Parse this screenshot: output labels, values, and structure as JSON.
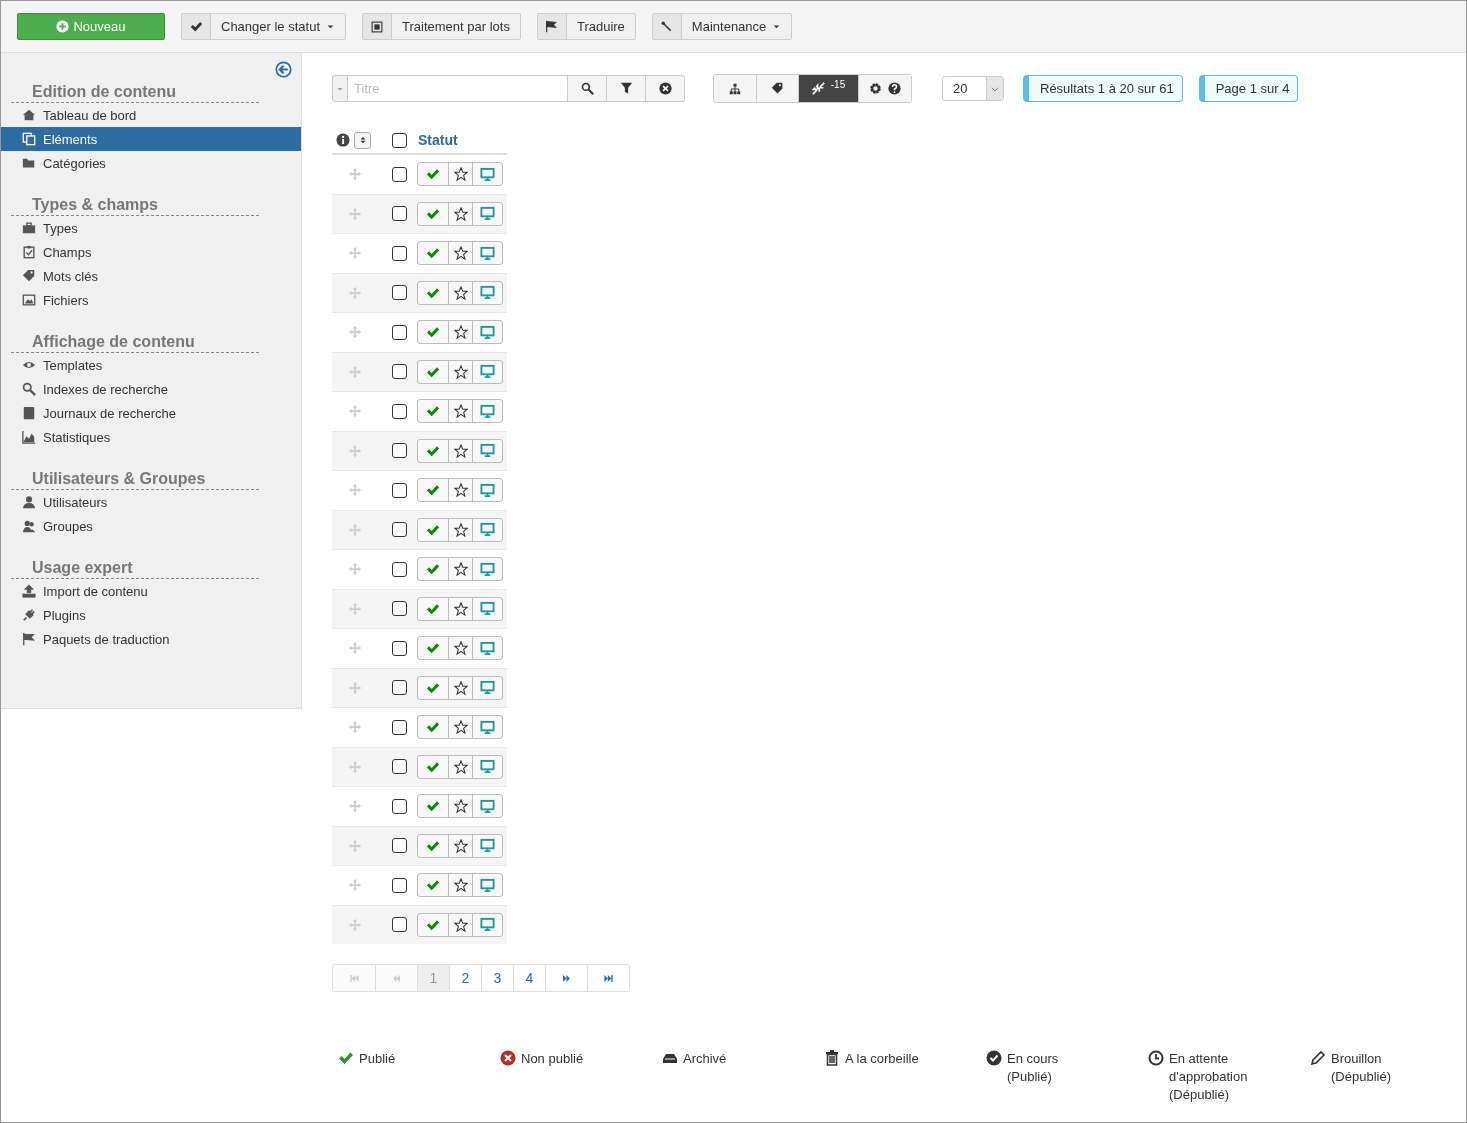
{
  "toolbar": [
    {
      "label": "Nouveau",
      "kind": "primary"
    },
    {
      "label": "Changer le statut",
      "kind": "dropdown"
    },
    {
      "label": "Traitement par lots",
      "kind": "split"
    },
    {
      "label": "Traduire",
      "kind": "split"
    },
    {
      "label": "Maintenance",
      "kind": "dropdown"
    }
  ],
  "sidebar": {
    "sections": [
      {
        "title": "Edition de contenu",
        "items": [
          {
            "label": "Tableau de bord",
            "selected": false
          },
          {
            "label": "Eléments",
            "selected": true
          },
          {
            "label": "Catégories",
            "selected": false
          }
        ]
      },
      {
        "title": "Types & champs",
        "items": [
          {
            "label": "Types",
            "selected": false
          },
          {
            "label": "Champs",
            "selected": false
          },
          {
            "label": "Mots clés",
            "selected": false
          },
          {
            "label": "Fichiers",
            "selected": false
          }
        ]
      },
      {
        "title": "Affichage de contenu",
        "items": [
          {
            "label": "Templates",
            "selected": false
          },
          {
            "label": "Indexes de recherche",
            "selected": false
          },
          {
            "label": "Journaux de recherche",
            "selected": false
          },
          {
            "label": "Statistiques",
            "selected": false
          }
        ]
      },
      {
        "title": "Utilisateurs & Groupes",
        "items": [
          {
            "label": "Utilisateurs",
            "selected": false
          },
          {
            "label": "Groupes",
            "selected": false
          }
        ]
      },
      {
        "title": "Usage expert",
        "items": [
          {
            "label": "Import de contenu",
            "selected": false
          },
          {
            "label": "Plugins",
            "selected": false
          },
          {
            "label": "Paquets de traduction",
            "selected": false
          }
        ]
      }
    ]
  },
  "filters": {
    "search": {
      "placeholder": "Titre"
    },
    "view_buttons": [
      {
        "selected": false
      },
      {
        "selected": false
      },
      {
        "selected": true,
        "badge": "-15"
      },
      {
        "selected": false
      }
    ],
    "page_size": "20",
    "results_label": "Résultats 1 à 20 sur 61",
    "page_label": "Page 1 sur 4"
  },
  "table": {
    "columns": [
      "Statut"
    ],
    "header_checked": false,
    "rows": [
      {
        "checked": false
      },
      {
        "checked": false
      },
      {
        "checked": false
      },
      {
        "checked": false
      },
      {
        "checked": false
      },
      {
        "checked": false
      },
      {
        "checked": false
      },
      {
        "checked": false
      },
      {
        "checked": false
      },
      {
        "checked": false
      },
      {
        "checked": false
      },
      {
        "checked": false
      },
      {
        "checked": false
      },
      {
        "checked": false
      },
      {
        "checked": false
      },
      {
        "checked": false
      },
      {
        "checked": false
      },
      {
        "checked": false
      },
      {
        "checked": false
      },
      {
        "checked": false
      }
    ]
  },
  "pagination": [
    {
      "kind": "first",
      "disabled": true
    },
    {
      "kind": "prev",
      "disabled": true
    },
    {
      "kind": "page",
      "label": "1",
      "selected": true
    },
    {
      "kind": "page",
      "label": "2",
      "selected": false
    },
    {
      "kind": "page",
      "label": "3",
      "selected": false
    },
    {
      "kind": "page",
      "label": "4",
      "selected": false
    },
    {
      "kind": "next",
      "disabled": false
    },
    {
      "kind": "last",
      "disabled": false
    }
  ],
  "legend": [
    {
      "kind": "published",
      "lines": [
        "Publié"
      ]
    },
    {
      "kind": "unpublished",
      "lines": [
        "Non publié"
      ]
    },
    {
      "kind": "archived",
      "lines": [
        "Archivé"
      ]
    },
    {
      "kind": "trashed",
      "lines": [
        "A la corbeille"
      ]
    },
    {
      "kind": "in_progress",
      "lines": [
        "En cours",
        "(Publié)"
      ]
    },
    {
      "kind": "pending",
      "lines": [
        "En attente",
        "d'approbation",
        "(Dépublié)"
      ]
    },
    {
      "kind": "draft",
      "lines": [
        "Brouillon",
        "(Dépublié)"
      ]
    }
  ]
}
